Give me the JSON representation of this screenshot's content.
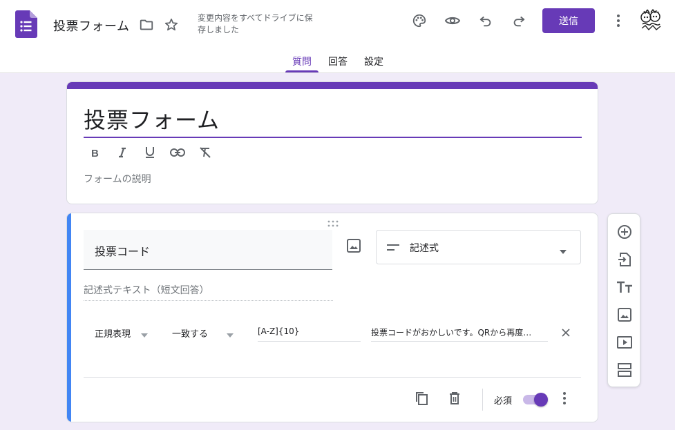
{
  "header": {
    "doc_title": "投票フォーム",
    "save_status": "変更内容をすべてドライブに保存しました",
    "send_label": "送信"
  },
  "tabs": [
    {
      "label": "質問",
      "active": true
    },
    {
      "label": "回答",
      "active": false
    },
    {
      "label": "設定",
      "active": false
    }
  ],
  "title_card": {
    "title": "投票フォーム",
    "description_placeholder": "フォームの説明",
    "format_tools": [
      "bold-icon",
      "italic-icon",
      "underline-icon",
      "link-icon",
      "clear-format-icon"
    ]
  },
  "question": {
    "title": "投票コード",
    "type_label": "記述式",
    "answer_hint": "記述式テキスト（短文回答）",
    "validation": {
      "category": "正規表現",
      "condition": "一致する",
      "pattern": "[A-Z]{10}",
      "error_text": "投票コードがおかしいです。QRから再度…"
    },
    "required_label": "必須",
    "required_on": true
  },
  "side_toolbar": [
    "add-question-icon",
    "import-questions-icon",
    "add-title-icon",
    "add-image-icon",
    "add-video-icon",
    "add-section-icon"
  ],
  "colors": {
    "accent": "#673ab7",
    "background": "#f0ebf8",
    "active_question_bar": "#4285f4"
  }
}
